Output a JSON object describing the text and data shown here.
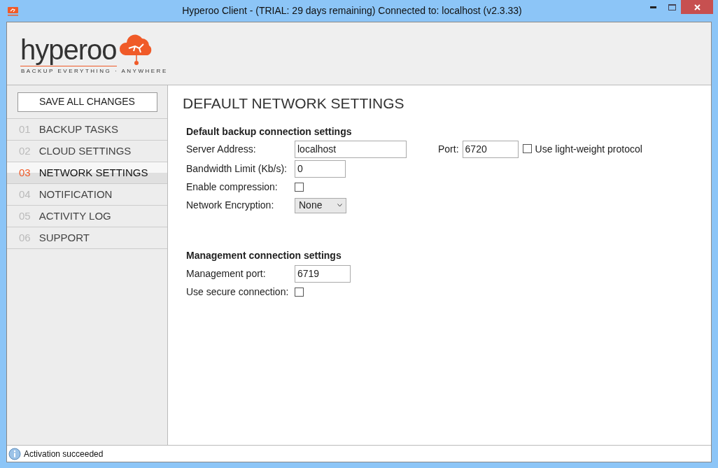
{
  "window": {
    "title": "Hyperoo Client - (TRIAL: 29 days remaining) Connected to: localhost (v2.3.33)"
  },
  "logo": {
    "wordmark": "hyperoo",
    "tagline": "BACKUP EVERYTHING · ANYWHERE"
  },
  "sidebar": {
    "save_button": "SAVE ALL CHANGES",
    "items": [
      {
        "number": "01",
        "label": "BACKUP TASKS",
        "selected": false
      },
      {
        "number": "02",
        "label": "CLOUD SETTINGS",
        "selected": false
      },
      {
        "number": "03",
        "label": "NETWORK SETTINGS",
        "selected": true
      },
      {
        "number": "04",
        "label": "NOTIFICATION",
        "selected": false
      },
      {
        "number": "05",
        "label": "ACTIVITY LOG",
        "selected": false
      },
      {
        "number": "06",
        "label": "SUPPORT",
        "selected": false
      }
    ]
  },
  "page": {
    "title": "DEFAULT NETWORK SETTINGS",
    "backup": {
      "heading": "Default backup connection settings",
      "server_address": {
        "label": "Server Address:",
        "value": "localhost"
      },
      "port": {
        "label": "Port:",
        "value": "6720"
      },
      "lightweight": {
        "label": "Use light-weight protocol",
        "checked": false
      },
      "bandwidth": {
        "label": "Bandwidth Limit (Kb/s):",
        "value": "0"
      },
      "compression": {
        "label": "Enable compression:",
        "checked": false
      },
      "encryption": {
        "label": "Network Encryption:",
        "value": "None"
      }
    },
    "management": {
      "heading": "Management connection settings",
      "port": {
        "label": "Management port:",
        "value": "6719"
      },
      "secure": {
        "label": "Use secure connection:",
        "checked": false
      }
    }
  },
  "status_bar": {
    "text": "Activation succeeded"
  }
}
